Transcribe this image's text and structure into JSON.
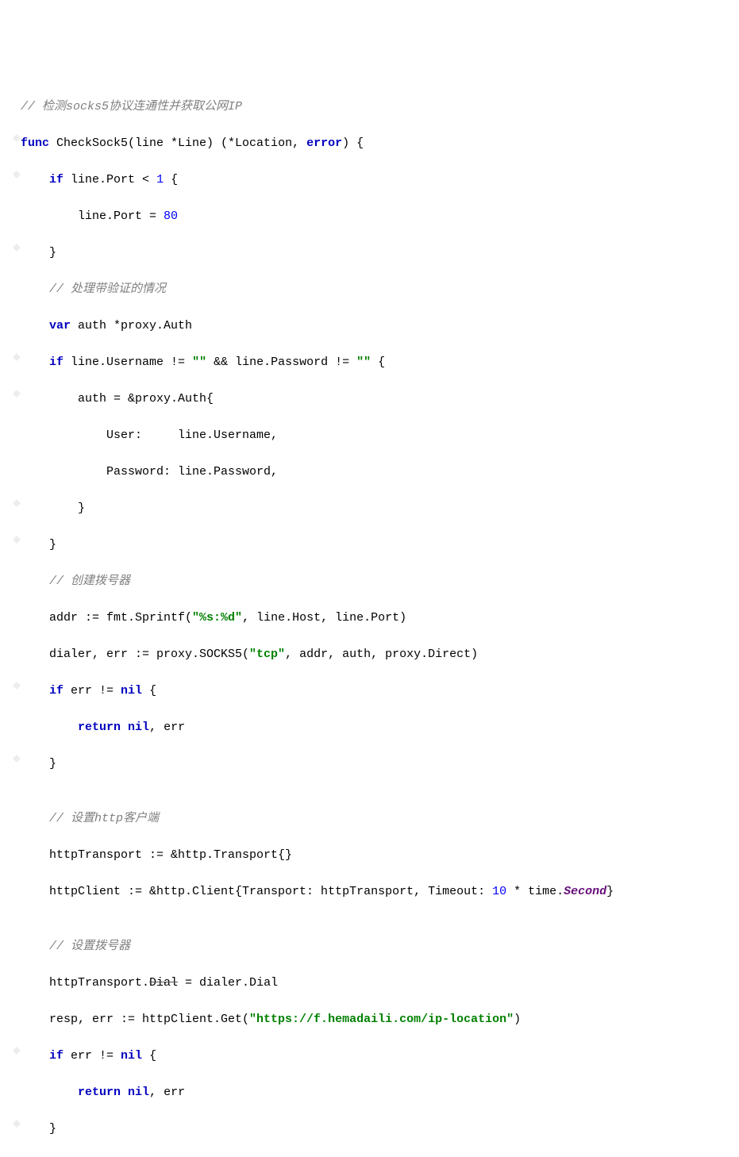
{
  "code": {
    "l0": {
      "c0": "// ",
      "c1": "检测socks5协议连通性并获取公网IP"
    },
    "l1": {
      "c0": "func",
      "c1": " CheckSock5(line *Line) (*Location, ",
      "c2": "error",
      "c3": ") {"
    },
    "l2": {
      "c0": "    ",
      "c1": "if",
      "c2": " line.Port < ",
      "c3": "1",
      "c4": " {"
    },
    "l3": {
      "c0": "        line.Port = ",
      "c1": "80"
    },
    "l4": {
      "c0": "    }"
    },
    "l5": {
      "c0": "    ",
      "c1": "// ",
      "c2": "处理带验证的情况"
    },
    "l6": {
      "c0": "    ",
      "c1": "var",
      "c2": " auth *proxy.Auth"
    },
    "l7": {
      "c0": "    ",
      "c1": "if",
      "c2": " line.Username != ",
      "c3": "\"\"",
      "c4": " && line.Password != ",
      "c5": "\"\"",
      "c6": " {"
    },
    "l8": {
      "c0": "        auth = &proxy.Auth{"
    },
    "l9": {
      "c0": "            User:     line.Username,"
    },
    "l10": {
      "c0": "            Password: line.Password,"
    },
    "l11": {
      "c0": "        }"
    },
    "l12": {
      "c0": "    }"
    },
    "l13": {
      "c0": "    ",
      "c1": "// ",
      "c2": "创建拨号器"
    },
    "l14": {
      "c0": "    addr := fmt.Sprintf(",
      "c1": "\"%s:%d\"",
      "c2": ", line.Host, line.Port)"
    },
    "l15": {
      "c0": "    dialer, err := proxy.SOCKS5(",
      "c1": "\"tcp\"",
      "c2": ", addr, auth, proxy.Direct)"
    },
    "l16": {
      "c0": "    ",
      "c1": "if",
      "c2": " err != ",
      "c3": "nil",
      "c4": " {"
    },
    "l17": {
      "c0": "        ",
      "c1": "return",
      "c2": " ",
      "c3": "nil",
      "c4": ", err"
    },
    "l18": {
      "c0": "    }"
    },
    "l19": {
      "c0": ""
    },
    "l20": {
      "c0": "    ",
      "c1": "// ",
      "c2": "设置http客户端"
    },
    "l21": {
      "c0": "    httpTransport := &http.Transport{}"
    },
    "l22": {
      "c0": "    httpClient := &http.Client{Transport: httpTransport, Timeout: ",
      "c1": "10",
      "c2": " * time.",
      "c3": "Second",
      "c4": "}"
    },
    "l23": {
      "c0": ""
    },
    "l24": {
      "c0": "    ",
      "c1": "// ",
      "c2": "设置拨号器"
    },
    "l25": {
      "c0": "    httpTransport.",
      "c1": "Dial",
      "c2": " = dialer.Dial"
    },
    "l26": {
      "c0": "    resp, err := httpClient.Get(",
      "c1": "\"https://f.hemadaili.com/ip-location\"",
      "c2": ")"
    },
    "l27": {
      "c0": "    ",
      "c1": "if",
      "c2": " err != ",
      "c3": "nil",
      "c4": " {"
    },
    "l28": {
      "c0": "        ",
      "c1": "return",
      "c2": " ",
      "c3": "nil",
      "c4": ", err"
    },
    "l29": {
      "c0": "    }"
    }
  }
}
